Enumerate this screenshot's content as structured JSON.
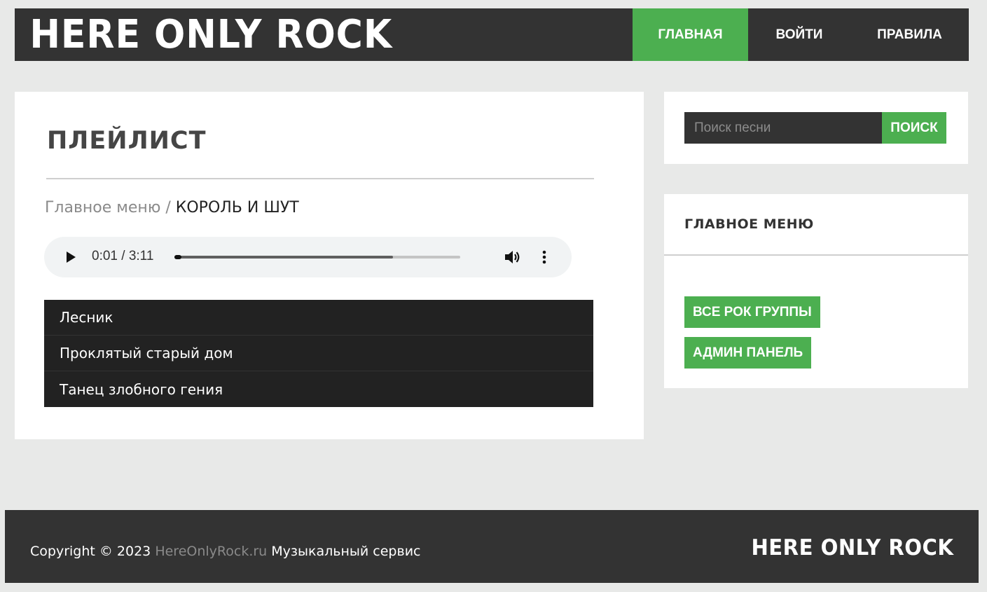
{
  "header": {
    "logo": "HERE ONLY ROCK",
    "nav": [
      {
        "label": "ГЛАВНАЯ",
        "active": true
      },
      {
        "label": "ВОЙТИ",
        "active": false
      },
      {
        "label": "ПРАВИЛА",
        "active": false
      }
    ]
  },
  "main": {
    "title": "ПЛЕЙЛИСТ",
    "breadcrumb": {
      "parent": "Главное меню",
      "separator": " / ",
      "current": "КОРОЛЬ И ШУТ"
    },
    "player": {
      "time": "0:01 / 3:11",
      "progress": 0.02,
      "buffered": 0.765
    },
    "songs": [
      "Лесник",
      "Проклятый старый дом",
      "Танец злобного гения"
    ]
  },
  "search": {
    "placeholder": "Поиск песни",
    "value": "",
    "button": "ПОИСК"
  },
  "menu": {
    "title": "ГЛАВНОЕ МЕНЮ",
    "buttons": [
      "ВСЕ РОК ГРУППЫ",
      "АДМИН ПАНЕЛЬ"
    ]
  },
  "footer": {
    "copyright_prefix": "Copyright © 2023",
    "site": "HereOnlyRock.ru",
    "suffix": "Музыкальный сервис",
    "logo": "HERE ONLY ROCK"
  },
  "colors": {
    "accent": "#4caf50",
    "dark": "#333333",
    "background": "#e8e9e8"
  },
  "icons": [
    "play-icon",
    "volume-icon",
    "more-vert-icon"
  ]
}
